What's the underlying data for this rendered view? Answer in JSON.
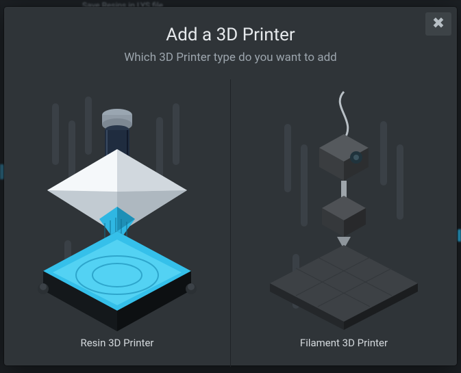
{
  "background": {
    "peek_text": "Save Resins in LYS file"
  },
  "modal": {
    "title": "Add a 3D Printer",
    "subtitle": "Which 3D Printer type do you want to add",
    "close_glyph": "✖",
    "options": {
      "resin": {
        "label": "Resin 3D Printer"
      },
      "filament": {
        "label": "Filament 3D Printer"
      }
    }
  }
}
